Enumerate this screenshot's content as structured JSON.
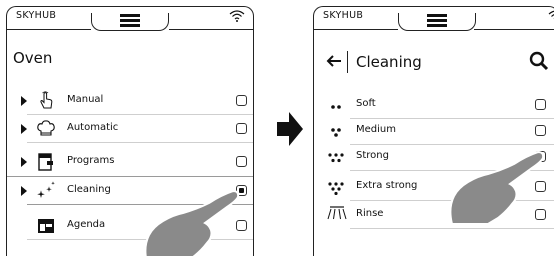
{
  "left_screen": {
    "brand": "SKYHUB",
    "title": "Oven",
    "items": [
      {
        "label": "Manual",
        "icon": "hand-pointer-icon",
        "checked": false
      },
      {
        "label": "Automatic",
        "icon": "chef-hat-icon",
        "checked": false
      },
      {
        "label": "Programs",
        "icon": "program-card-icon",
        "checked": false
      },
      {
        "label": "Cleaning",
        "icon": "sparkle-icon",
        "checked": true
      },
      {
        "label": "Agenda",
        "icon": "calendar-icon",
        "checked": false
      }
    ]
  },
  "right_screen": {
    "brand": "SKYHUB",
    "title": "Cleaning",
    "items": [
      {
        "label": "Soft",
        "icon": "drops-2-icon",
        "checked": false
      },
      {
        "label": "Medium",
        "icon": "drops-3-icon",
        "checked": false
      },
      {
        "label": "Strong",
        "icon": "drops-5-icon",
        "checked": true
      },
      {
        "label": "Extra strong",
        "icon": "drops-6-icon",
        "checked": false
      },
      {
        "label": "Rinse",
        "icon": "shower-icon",
        "checked": false
      }
    ]
  },
  "colors": {
    "hand": "#8a8a8a",
    "line": "#222222",
    "separator": "#cfcfcf"
  }
}
